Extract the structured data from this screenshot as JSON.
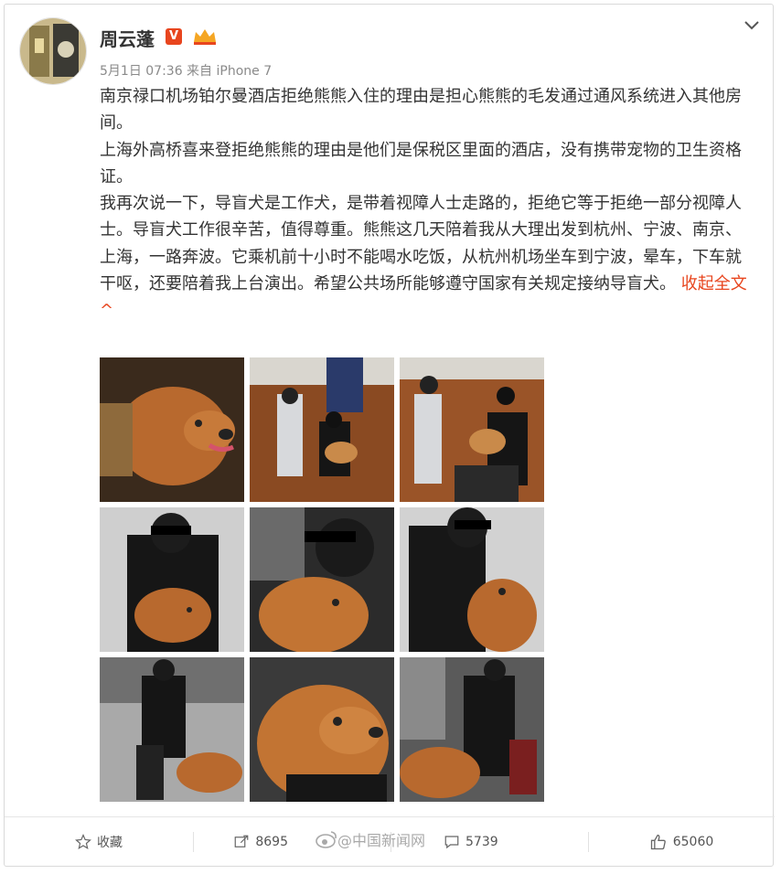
{
  "user": {
    "name": "周云蓬",
    "verified_badge": "V",
    "meta": "5月1日 07:36 来自 iPhone 7"
  },
  "post": {
    "paragraphs": [
      "南京禄口机场铂尔曼酒店拒绝熊熊入住的理由是担心熊熊的毛发通过通风系统进入其他房间。",
      "上海外高桥喜来登拒绝熊熊的理由是他们是保税区里面的酒店，没有携带宠物的卫生资格证。",
      "我再次说一下，导盲犬是工作犬，是带着视障人士走路的，拒绝它等于拒绝一部分视障人士。导盲犬工作很辛苦，值得尊重。熊熊这几天陪着我从大理出发到杭州、宁波、南京、上海，一路奔波。它乘机前十小时不能喝水吃饭，从杭州机场坐车到宁波，晕车，下车就干呕，还要陪着我上台演出。希望公共场所能够遵守国家有关规定接纳导盲犬。"
    ],
    "collapse_label": "收起全文",
    "collapse_arrow": "^"
  },
  "actions": {
    "favorite": "收藏",
    "repost": "8695",
    "comment": "5739",
    "like": "65060"
  },
  "watermark": "@中国新闻网",
  "colors": {
    "accent": "#e8451e",
    "muted": "#8a8a8a"
  },
  "icons": [
    "chevron-down-icon",
    "crown-icon",
    "star-icon",
    "repost-icon",
    "comment-icon",
    "thumbs-up-icon",
    "weibo-logo-icon"
  ]
}
